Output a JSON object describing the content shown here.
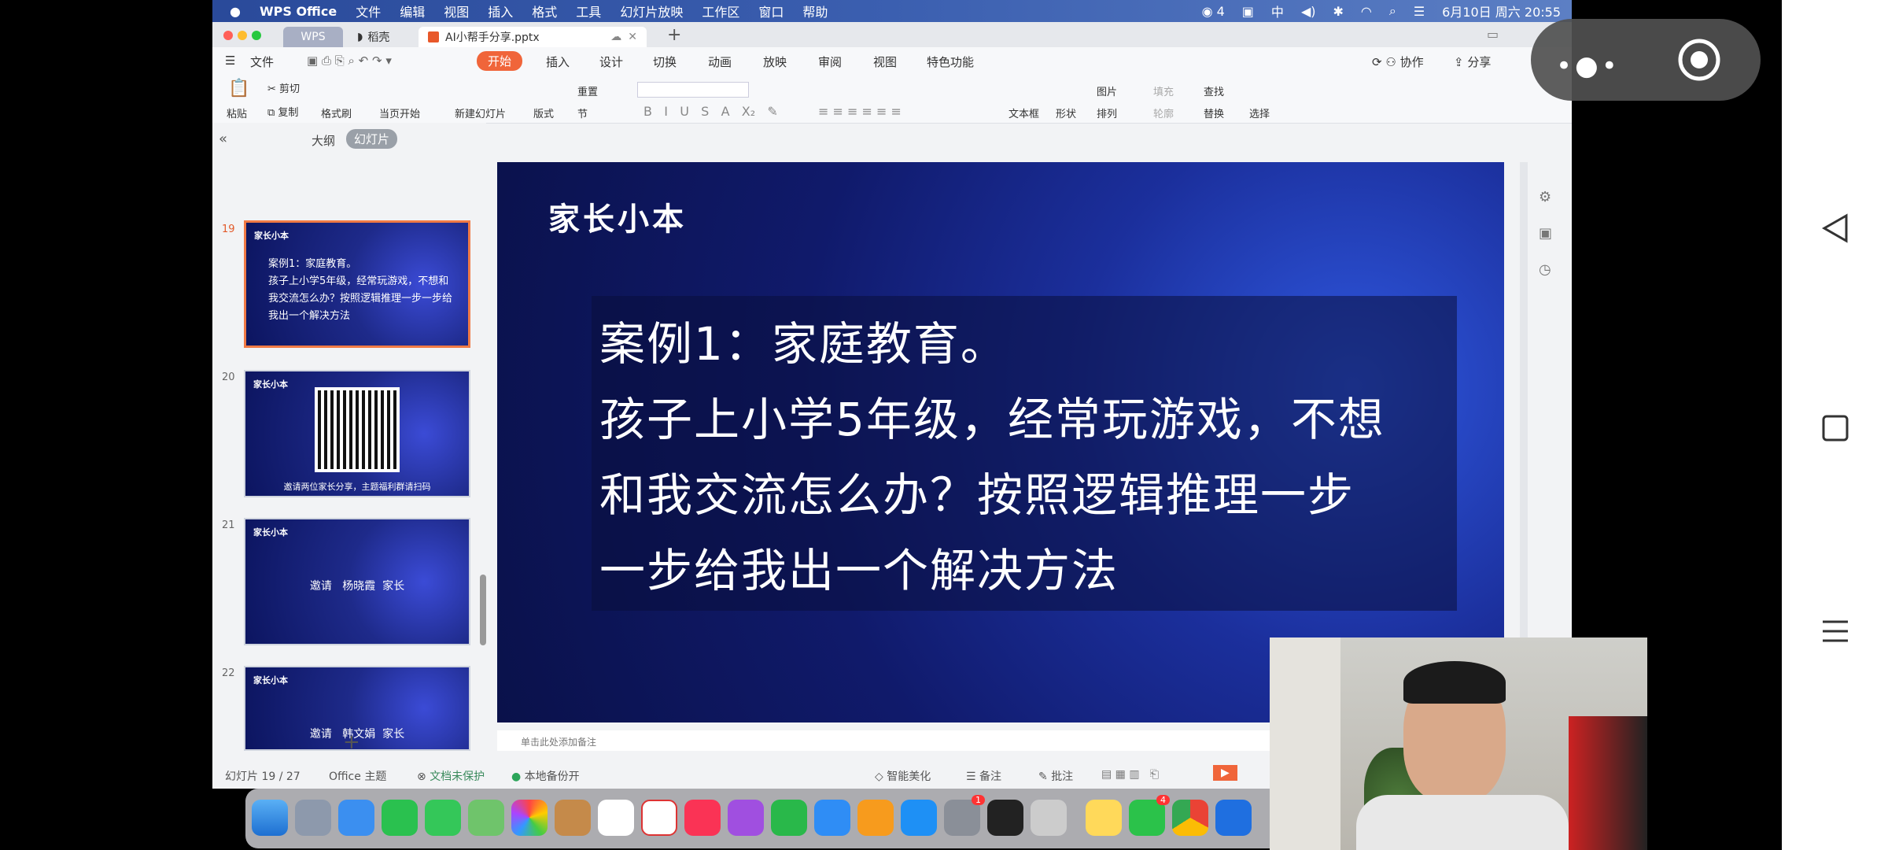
{
  "menubar": {
    "app": "WPS Office",
    "items": [
      "文件",
      "编辑",
      "视图",
      "插入",
      "格式",
      "工具",
      "幻灯片放映",
      "工作区",
      "窗口",
      "帮助"
    ],
    "status_count": "4",
    "datetime": "6月10日 周六 20:55"
  },
  "tabs": {
    "wps": "WPS",
    "daoke": "稻壳",
    "doc": "AI小帮手分享.pptx"
  },
  "menu": {
    "file": "文件",
    "items": [
      "开始",
      "插入",
      "设计",
      "切换",
      "动画",
      "放映",
      "审阅",
      "视图",
      "特色功能"
    ],
    "collab": "协作",
    "share": "分享"
  },
  "ribbon": {
    "paste": "粘贴",
    "cut": "剪切",
    "copy": "复制",
    "format_painter": "格式刷",
    "from_current": "当页开始",
    "new_slide": "新建幻灯片",
    "layout": "版式",
    "section": "节",
    "reset": "重置",
    "textbox": "文本框",
    "shape": "形状",
    "image": "图片",
    "arrange": "排列",
    "fill": "填充",
    "outline": "轮廓",
    "find": "查找",
    "replace": "替换",
    "select": "选择"
  },
  "panel": {
    "outline_tab": "大纲",
    "slides_tab": "幻灯片",
    "thumbs": [
      {
        "num": "19",
        "logo": "家长小本",
        "text": "案例1：家庭教育。\n孩子上小学5年级，经常玩游戏，不想和我交流怎么办？按照逻辑推理一步一步给我出一个解决方法"
      },
      {
        "num": "20",
        "logo": "家长小本",
        "text": "邀请两位家长分享，主题福利群请扫码"
      },
      {
        "num": "21",
        "logo": "家长小本",
        "text": "邀请   杨晓霞  家长"
      },
      {
        "num": "22",
        "logo": "家长小本",
        "text": "邀请   韩文娟  家长"
      }
    ]
  },
  "slide": {
    "logo": "家长小本",
    "line1": "案例1：家庭教育。",
    "line2": "孩子上小学5年级，经常玩游戏，不想",
    "line3": "和我交流怎么办？按照逻辑推理一步",
    "line4": "一步给我出一个解决方法"
  },
  "notes_placeholder": "单击此处添加备注",
  "status": {
    "slide_count": "幻灯片 19 / 27",
    "theme": "Office 主题",
    "protect": "文档未保护",
    "backup": "本地备份开",
    "beautify": "智能美化",
    "notes": "备注",
    "comment": "批注"
  },
  "dock": {
    "badge_settings": "1",
    "badge_wechat": "4"
  }
}
